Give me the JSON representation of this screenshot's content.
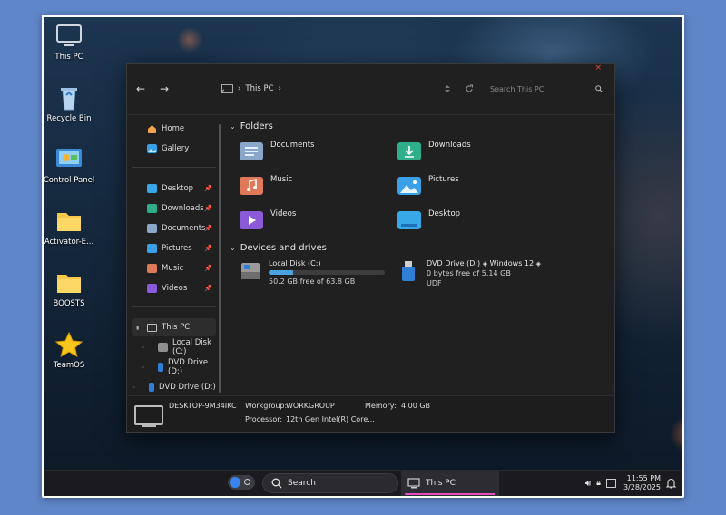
{
  "desktop": {
    "icons": [
      {
        "label": "This PC",
        "icon": "monitor-icon"
      },
      {
        "label": "Recycle Bin",
        "icon": "recycle-bin-icon"
      },
      {
        "label": "Control Panel",
        "icon": "control-panel-icon"
      },
      {
        "label": "Activator-E...",
        "icon": "folder-icon"
      },
      {
        "label": "BOOSTS",
        "icon": "folder-icon"
      },
      {
        "label": "TeamOS",
        "icon": "star-icon"
      }
    ]
  },
  "explorer": {
    "close_glyph": "×",
    "back_glyph": "←",
    "forward_glyph": "→",
    "expand_glyph": "⌄",
    "address": {
      "location": "This PC",
      "chevron": "›"
    },
    "search": {
      "placeholder": "Search This PC"
    },
    "sidebar": {
      "top": [
        {
          "label": "Home",
          "icon": "home-icon"
        },
        {
          "label": "Gallery",
          "icon": "gallery-icon"
        }
      ],
      "pinned": [
        {
          "label": "Desktop",
          "icon": "desktop-folder-icon"
        },
        {
          "label": "Downloads",
          "icon": "downloads-folder-icon"
        },
        {
          "label": "Documents",
          "icon": "documents-folder-icon"
        },
        {
          "label": "Pictures",
          "icon": "pictures-folder-icon"
        },
        {
          "label": "Music",
          "icon": "music-folder-icon"
        },
        {
          "label": "Videos",
          "icon": "videos-folder-icon"
        }
      ],
      "this_pc": {
        "label": "This PC",
        "icon": "monitor-icon"
      },
      "drives": [
        {
          "label": "Local Disk (C:)",
          "icon": "hard-drive-icon"
        },
        {
          "label": "DVD Drive (D:)",
          "icon": "usb-drive-icon"
        },
        {
          "label": "DVD Drive (D:)",
          "icon": "usb-drive-icon"
        }
      ]
    },
    "folders_section": {
      "title": "Folders",
      "chevron": "⌄"
    },
    "folders": [
      {
        "label": "Documents",
        "color": "#8aa6c8",
        "icon": "documents-folder-icon"
      },
      {
        "label": "Downloads",
        "color": "#2fae8c",
        "icon": "downloads-folder-icon"
      },
      {
        "label": "Music",
        "color": "#e0785a",
        "icon": "music-folder-icon"
      },
      {
        "label": "Pictures",
        "color": "#3aa0e8",
        "icon": "pictures-folder-icon"
      },
      {
        "label": "Videos",
        "color": "#8a5ad8",
        "icon": "videos-folder-icon"
      },
      {
        "label": "Desktop",
        "color": "#38a8e8",
        "icon": "desktop-folder-icon"
      }
    ],
    "drives_section": {
      "title": "Devices and drives",
      "chevron": "⌄"
    },
    "drives": [
      {
        "name": "Local Disk (C:)",
        "free_text": "50.2 GB free of 63.8 GB",
        "used_fraction": 0.21
      },
      {
        "name": "DVD Drive (D:)",
        "extra": "Windows 12",
        "free_text": "0 bytes free of 5.14 GB",
        "fs": "UDF"
      }
    ],
    "details": {
      "pc_name": "DESKTOP-9M34IKC",
      "workgroup_label": "Workgroup:",
      "workgroup": "WORKGROUP",
      "memory_label": "Memory:",
      "memory": "4.00 GB",
      "processor_label": "Processor:",
      "processor": "12th Gen Intel(R) Core..."
    }
  },
  "taskbar": {
    "search_label": "Search",
    "app_label": "This PC",
    "time": "11:55 PM",
    "date": "3/28/2025",
    "accent": "#e050c0"
  }
}
